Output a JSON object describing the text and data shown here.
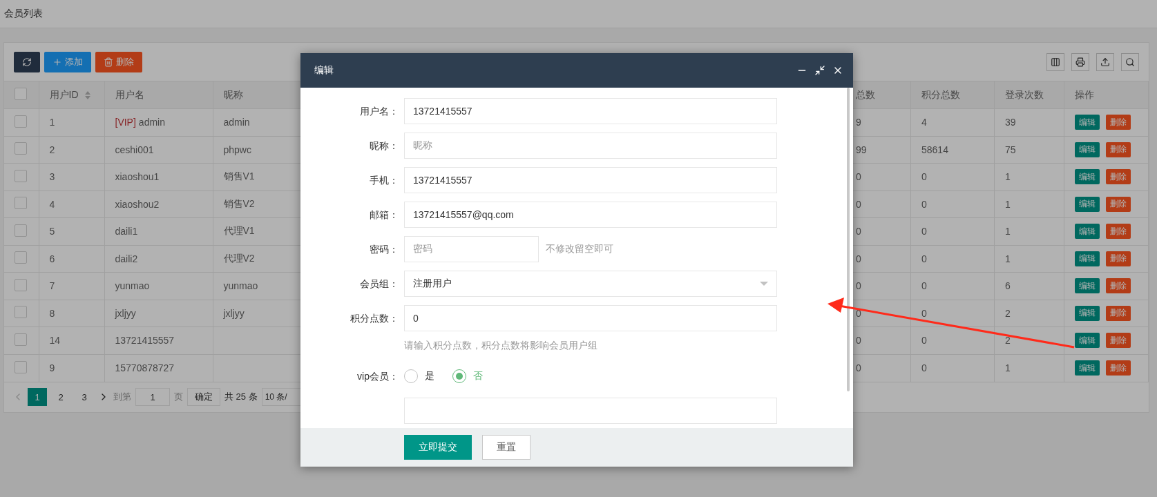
{
  "page_title": "会员列表",
  "toolbar": [
    {
      "kind": "refresh"
    },
    {
      "kind": "add",
      "label": "添加"
    },
    {
      "kind": "delete",
      "label": "删除"
    }
  ],
  "table": {
    "header_checked": false,
    "columns": [
      {
        "label": "用户ID",
        "sortable": true
      },
      {
        "label": "用户名",
        "sortable": false
      },
      {
        "label": "昵称",
        "sortable": false
      },
      {
        "label": "总数",
        "sortable": false
      },
      {
        "label": "积分总数",
        "sortable": false
      },
      {
        "label": "登录次数",
        "sortable": false
      },
      {
        "label": "操作",
        "sortable": false
      }
    ],
    "rows": [
      {
        "checked": false,
        "id": "1",
        "vip_tag": "[VIP]",
        "username": "admin",
        "nickname": "admin",
        "total": "9",
        "points": "4",
        "logins": "39",
        "actions": [
          "编辑",
          "删除"
        ]
      },
      {
        "checked": false,
        "id": "2",
        "username": "ceshi001",
        "nickname": "phpwc",
        "total": "99",
        "points": "58614",
        "logins": "75",
        "actions": [
          "编辑",
          "删除"
        ]
      },
      {
        "checked": false,
        "id": "3",
        "username": "xiaoshou1",
        "nickname": "销售V1",
        "total": "0",
        "points": "0",
        "logins": "1",
        "actions": [
          "编辑",
          "删除"
        ]
      },
      {
        "checked": false,
        "id": "4",
        "username": "xiaoshou2",
        "nickname": "销售V2",
        "total": "0",
        "points": "0",
        "logins": "1",
        "actions": [
          "编辑",
          "删除"
        ]
      },
      {
        "checked": false,
        "id": "5",
        "username": "daili1",
        "nickname": "代理V1",
        "total": "0",
        "points": "0",
        "logins": "1",
        "actions": [
          "编辑",
          "删除"
        ]
      },
      {
        "checked": false,
        "id": "6",
        "username": "daili2",
        "nickname": "代理V2",
        "total": "0",
        "points": "0",
        "logins": "1",
        "actions": [
          "编辑",
          "删除"
        ]
      },
      {
        "checked": false,
        "id": "7",
        "username": "yunmao",
        "nickname": "yunmao",
        "total": "0",
        "points": "0",
        "logins": "6",
        "actions": [
          "编辑",
          "删除"
        ]
      },
      {
        "checked": false,
        "id": "8",
        "username": "jxljyy",
        "nickname": "jxljyy",
        "total": "0",
        "points": "0",
        "logins": "2",
        "actions": [
          "编辑",
          "删除"
        ]
      },
      {
        "checked": false,
        "id": "14",
        "username": "13721415557",
        "total": "0",
        "points": "0",
        "logins": "2",
        "actions": [
          "编辑",
          "删除"
        ]
      },
      {
        "checked": false,
        "id": "9",
        "username": "15770878727",
        "total": "0",
        "points": "0",
        "logins": "1",
        "actions": [
          "编辑",
          "删除"
        ]
      }
    ]
  },
  "pager": {
    "pages": [
      {
        "label": "1",
        "selected": true
      },
      {
        "label": "2",
        "selected": false
      },
      {
        "label": "3",
        "selected": false
      }
    ],
    "goto_label": "到第",
    "goto_value": "1",
    "page_unit": "页",
    "confirm": "确定",
    "total": "共 25 条",
    "page_size": "10 条/"
  },
  "modal": {
    "title": "编辑",
    "fields": [
      {
        "kind": "text",
        "label": "用户名：",
        "value": "13721415557"
      },
      {
        "kind": "text",
        "label": "昵称：",
        "placeholder": "昵称"
      },
      {
        "kind": "text",
        "label": "手机：",
        "value": "13721415557"
      },
      {
        "kind": "text",
        "label": "邮箱：",
        "value": "13721415557@qq.com"
      },
      {
        "kind": "password",
        "label": "密码：",
        "placeholder": "密码",
        "hint": "不修改留空即可"
      },
      {
        "kind": "select",
        "label": "会员组：",
        "value": "注册用户"
      },
      {
        "kind": "text",
        "label": "积分点数：",
        "value": "0",
        "help": "请输入积分点数，积分点数将影响会员用户组"
      },
      {
        "kind": "radio",
        "label": "vip会员：",
        "options": [
          {
            "label": "是",
            "selected": false
          },
          {
            "label": "否",
            "selected": true
          }
        ]
      },
      {
        "kind": "partial"
      }
    ],
    "buttons": [
      {
        "kind": "primary",
        "label": "立即提交"
      },
      {
        "kind": "default",
        "label": "重置"
      }
    ]
  }
}
